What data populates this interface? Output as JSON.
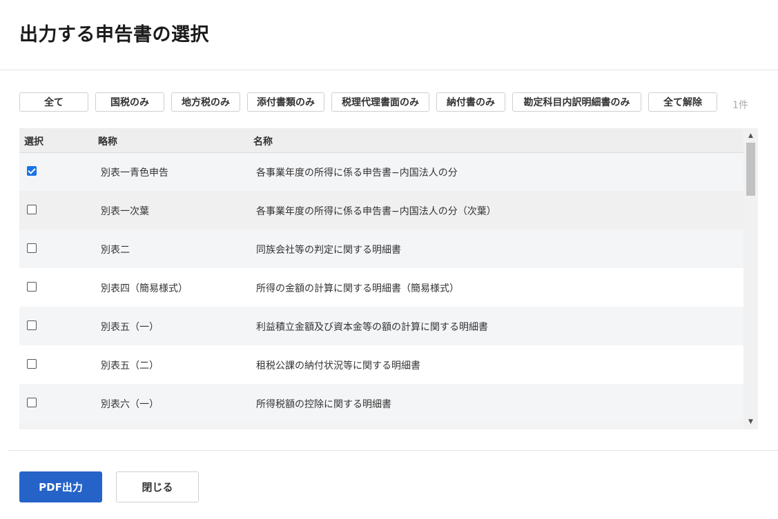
{
  "page": {
    "title": "出力する申告書の選択"
  },
  "filters": {
    "buttons": [
      "全て",
      "国税のみ",
      "地方税のみ",
      "添付書類のみ",
      "税理代理書面のみ",
      "納付書のみ",
      "勘定科目内訳明細書のみ",
      "全て解除"
    ],
    "count": "1件"
  },
  "table": {
    "headers": {
      "select": "選択",
      "abbr": "略称",
      "name": "名称"
    },
    "rows": [
      {
        "checked": true,
        "abbr": "別表一青色申告",
        "name": "各事業年度の所得に係る申告書−内国法人の分"
      },
      {
        "checked": false,
        "abbr": "別表一次葉",
        "name": "各事業年度の所得に係る申告書−内国法人の分（次葉）"
      },
      {
        "checked": false,
        "abbr": "別表二",
        "name": "同族会社等の判定に関する明細書"
      },
      {
        "checked": false,
        "abbr": "別表四（簡易様式）",
        "name": "所得の金額の計算に関する明細書（簡易様式）"
      },
      {
        "checked": false,
        "abbr": "別表五（一）",
        "name": "利益積立金額及び資本金等の額の計算に関する明細書"
      },
      {
        "checked": false,
        "abbr": "別表五（二）",
        "name": "租税公課の納付状況等に関する明細書"
      },
      {
        "checked": false,
        "abbr": "別表六（一）",
        "name": "所得税額の控除に関する明細書"
      }
    ]
  },
  "footer": {
    "pdf_label": "PDF出力",
    "close_label": "閉じる"
  },
  "icons": {
    "scroll_up": "triangle-up-icon",
    "scroll_down": "triangle-down-icon",
    "check": "checkmark-icon"
  },
  "colors": {
    "primary": "#2563c9",
    "checkbox_checked": "#1a73e8"
  }
}
